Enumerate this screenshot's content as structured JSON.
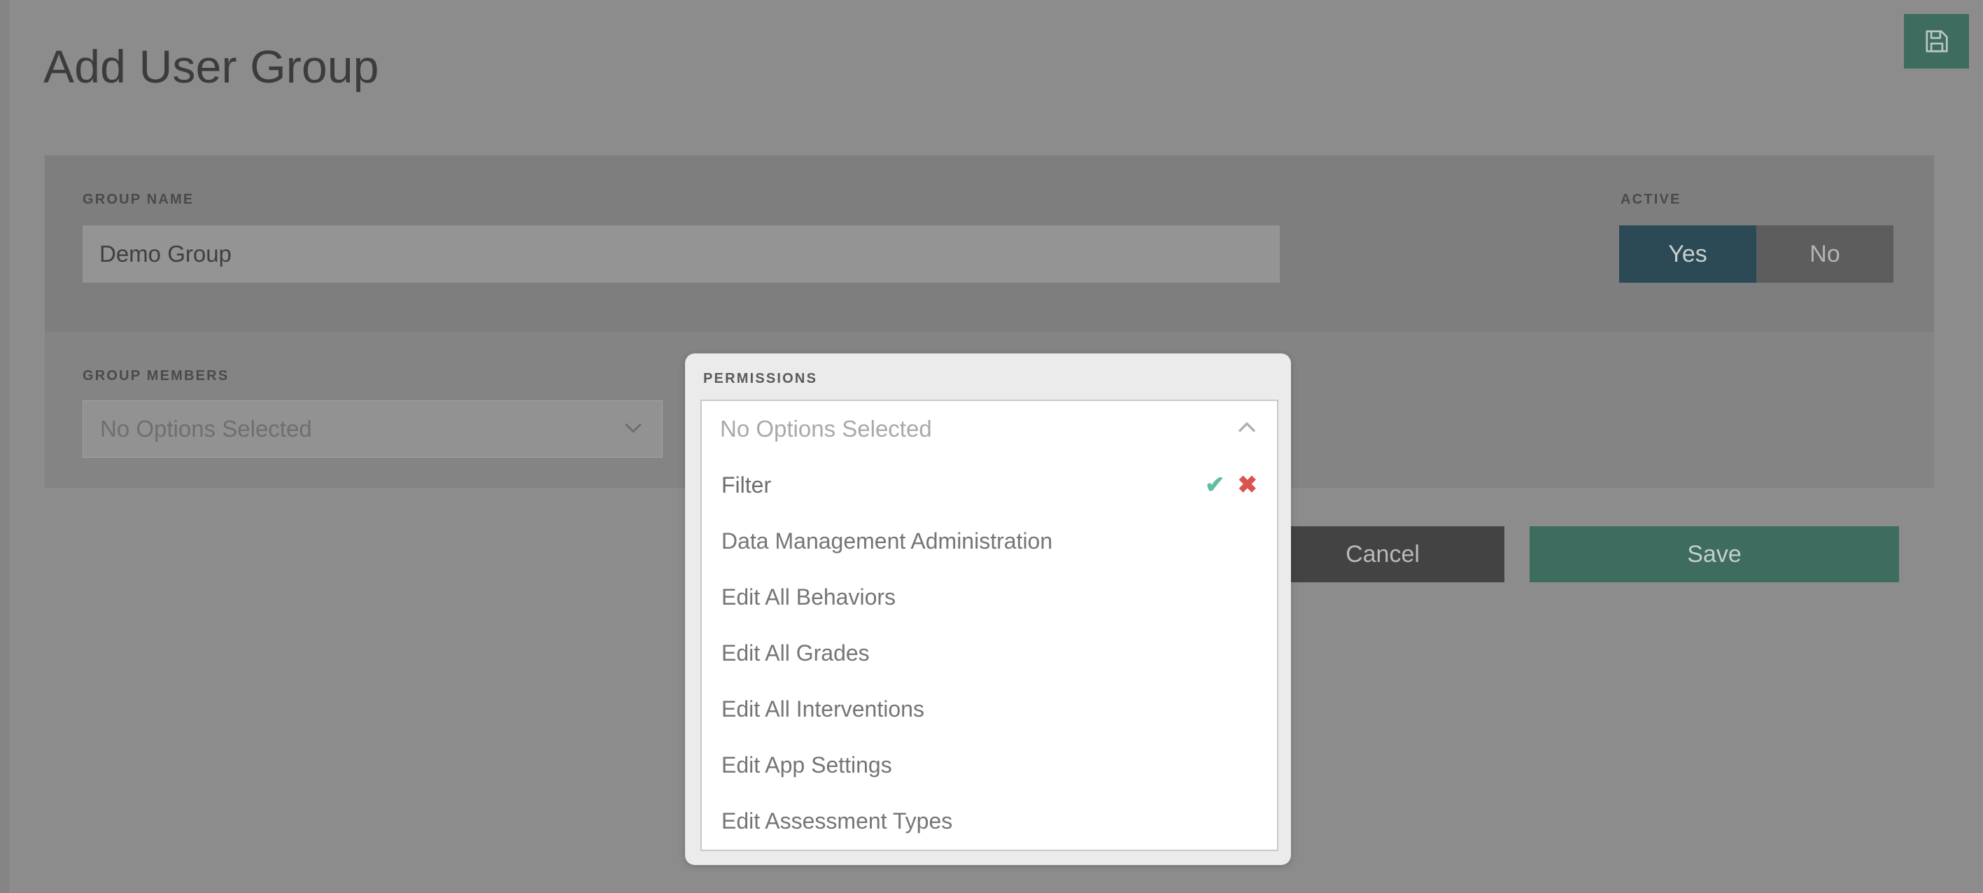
{
  "page": {
    "title": "Add User Group",
    "background_color": "#8c8c8c"
  },
  "topbar": {
    "save_icon": "floppy-disk-save-icon",
    "save_button_color": "#3e6c5f"
  },
  "form": {
    "group_name": {
      "label": "GROUP NAME",
      "value": "Demo Group",
      "placeholder": "Group Name"
    },
    "active": {
      "label": "ACTIVE",
      "yes_label": "Yes",
      "no_label": "No",
      "selected": "Yes",
      "selected_color": "#2b4a55",
      "unselected_color": "#5d5d5d"
    },
    "group_members": {
      "label": "GROUP MEMBERS",
      "value": "No Options Selected",
      "chevron_icon": "chevron-down-icon"
    }
  },
  "footer": {
    "cancel_label": "Cancel",
    "cancel_color": "#434343",
    "save_label": "Save",
    "save_color": "#3e6c5f"
  },
  "permissions_modal": {
    "label": "PERMISSIONS",
    "selected_summary": "No Options Selected",
    "chevron_icon": "chevron-up-icon",
    "filter": {
      "placeholder": "Filter",
      "value": "",
      "confirm_icon": "check-icon",
      "confirm_color": "#63bda4",
      "clear_icon": "cross-icon",
      "clear_color": "#d9544a"
    },
    "options": [
      "Data Management Administration",
      "Edit All Behaviors",
      "Edit All Grades",
      "Edit All Interventions",
      "Edit App Settings",
      "Edit Assessment Types"
    ]
  }
}
